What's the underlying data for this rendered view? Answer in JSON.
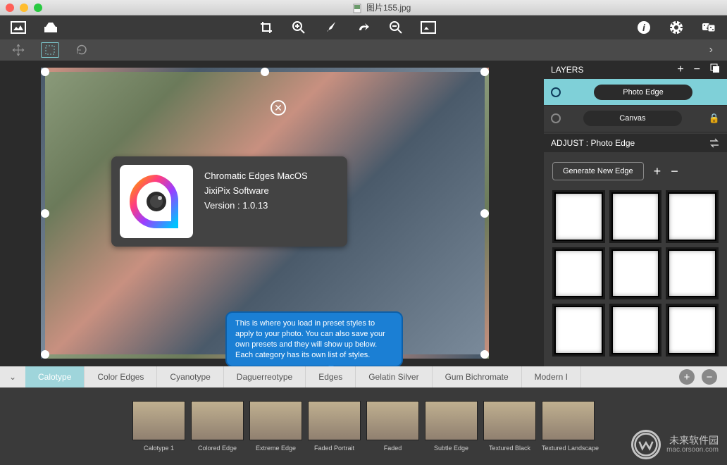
{
  "window": {
    "title": "图片155.jpg"
  },
  "about": {
    "line1": "Chromatic Edges MacOS",
    "line2": "JixiPix Software",
    "line3": "Version : 1.0.13"
  },
  "tooltip": "This is where you load in preset styles to apply to your photo. You can also save your own presets and they will show up below. Each category has its own list of styles.",
  "layers": {
    "header": "LAYERS",
    "items": [
      {
        "label": "Photo Edge",
        "active": true,
        "locked": false
      },
      {
        "label": "Canvas",
        "active": false,
        "locked": true
      }
    ]
  },
  "adjust": {
    "header": "ADJUST : Photo Edge",
    "generate": "Generate New Edge"
  },
  "preset_tabs": [
    "Calotype",
    "Color Edges",
    "Cyanotype",
    "Daguerreotype",
    "Edges",
    "Gelatin Silver",
    "Gum Bichromate",
    "Modern I"
  ],
  "presets": [
    "Calotype 1",
    "Colored Edge",
    "Extreme Edge",
    "Faded Portrait",
    "Faded",
    "Subtle Edge",
    "Textured Black",
    "Textured Landscape"
  ],
  "watermark": {
    "brand": "未来软件园",
    "url": "mac.orsoon.com"
  }
}
